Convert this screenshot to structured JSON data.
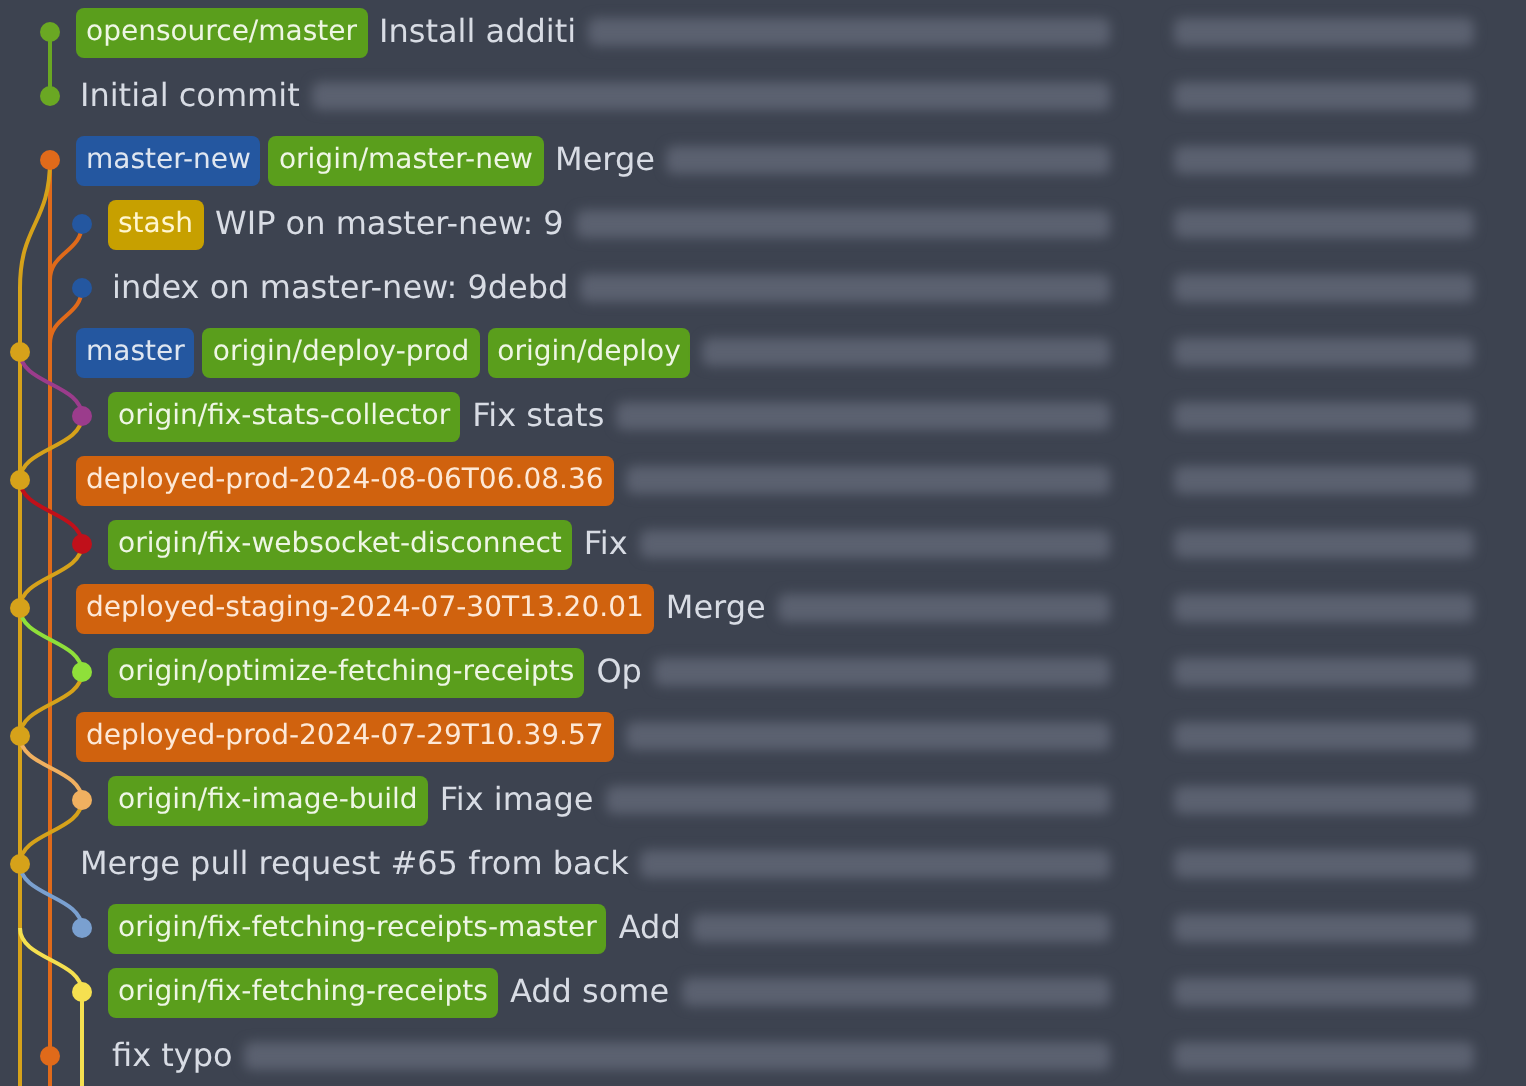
{
  "commits": [
    {
      "kind": "middle",
      "color": "#6aa823",
      "refs": [
        {
          "kind": "remote",
          "text": "opensource/master"
        }
      ],
      "message": "Install additi"
    },
    {
      "kind": "middle",
      "color": "#6aa823",
      "message": "Initial commit"
    },
    {
      "kind": "middle",
      "color": "#e06a1a",
      "refs": [
        {
          "kind": "local",
          "text": "master-new"
        },
        {
          "kind": "remote",
          "text": "origin/master-new"
        }
      ],
      "message": "Merge"
    },
    {
      "kind": "right",
      "color": "#2457a0",
      "refs": [
        {
          "kind": "stash",
          "text": "stash"
        }
      ],
      "message": "WIP on master-new: 9"
    },
    {
      "kind": "right",
      "color": "#2457a0",
      "message": "index on master-new: 9debd"
    },
    {
      "kind": "left",
      "color": "#d6a21a",
      "refs": [
        {
          "kind": "local",
          "text": "master"
        },
        {
          "kind": "remote",
          "text": "origin/deploy-prod"
        },
        {
          "kind": "remote",
          "text": "origin/deploy"
        }
      ]
    },
    {
      "kind": "right",
      "color": "#9b3c8c",
      "refs": [
        {
          "kind": "remote",
          "text": "origin/fix-stats-collector"
        }
      ],
      "message": "Fix stats"
    },
    {
      "kind": "left",
      "color": "#d6a21a",
      "refs": [
        {
          "kind": "tag",
          "text": "deployed-prod-2024-08-06T06.08.36"
        }
      ]
    },
    {
      "kind": "right",
      "color": "#c0101a",
      "refs": [
        {
          "kind": "remote",
          "text": "origin/fix-websocket-disconnect"
        }
      ],
      "message": "Fix"
    },
    {
      "kind": "left",
      "color": "#d6a21a",
      "refs": [
        {
          "kind": "tag",
          "text": "deployed-staging-2024-07-30T13.20.01"
        }
      ],
      "message": "Merge"
    },
    {
      "kind": "right",
      "color": "#8fe03a",
      "refs": [
        {
          "kind": "remote",
          "text": "origin/optimize-fetching-receipts"
        }
      ],
      "message": "Op"
    },
    {
      "kind": "left",
      "color": "#d6a21a",
      "refs": [
        {
          "kind": "tag",
          "text": "deployed-prod-2024-07-29T10.39.57"
        }
      ]
    },
    {
      "kind": "right",
      "color": "#f0b060",
      "refs": [
        {
          "kind": "remote",
          "text": "origin/fix-image-build"
        }
      ],
      "message": "Fix image"
    },
    {
      "kind": "left",
      "color": "#d6a21a",
      "message": "Merge pull request #65 from back"
    },
    {
      "kind": "right",
      "color": "#7aa0d0",
      "refs": [
        {
          "kind": "remote",
          "text": "origin/fix-fetching-receipts-master"
        }
      ],
      "message": "Add"
    },
    {
      "kind": "right",
      "color": "#f5e050",
      "refs": [
        {
          "kind": "remote",
          "text": "origin/fix-fetching-receipts"
        }
      ],
      "message": "Add some"
    },
    {
      "kind": "middle",
      "color": "#e06a1a",
      "message": "fix typo"
    }
  ]
}
